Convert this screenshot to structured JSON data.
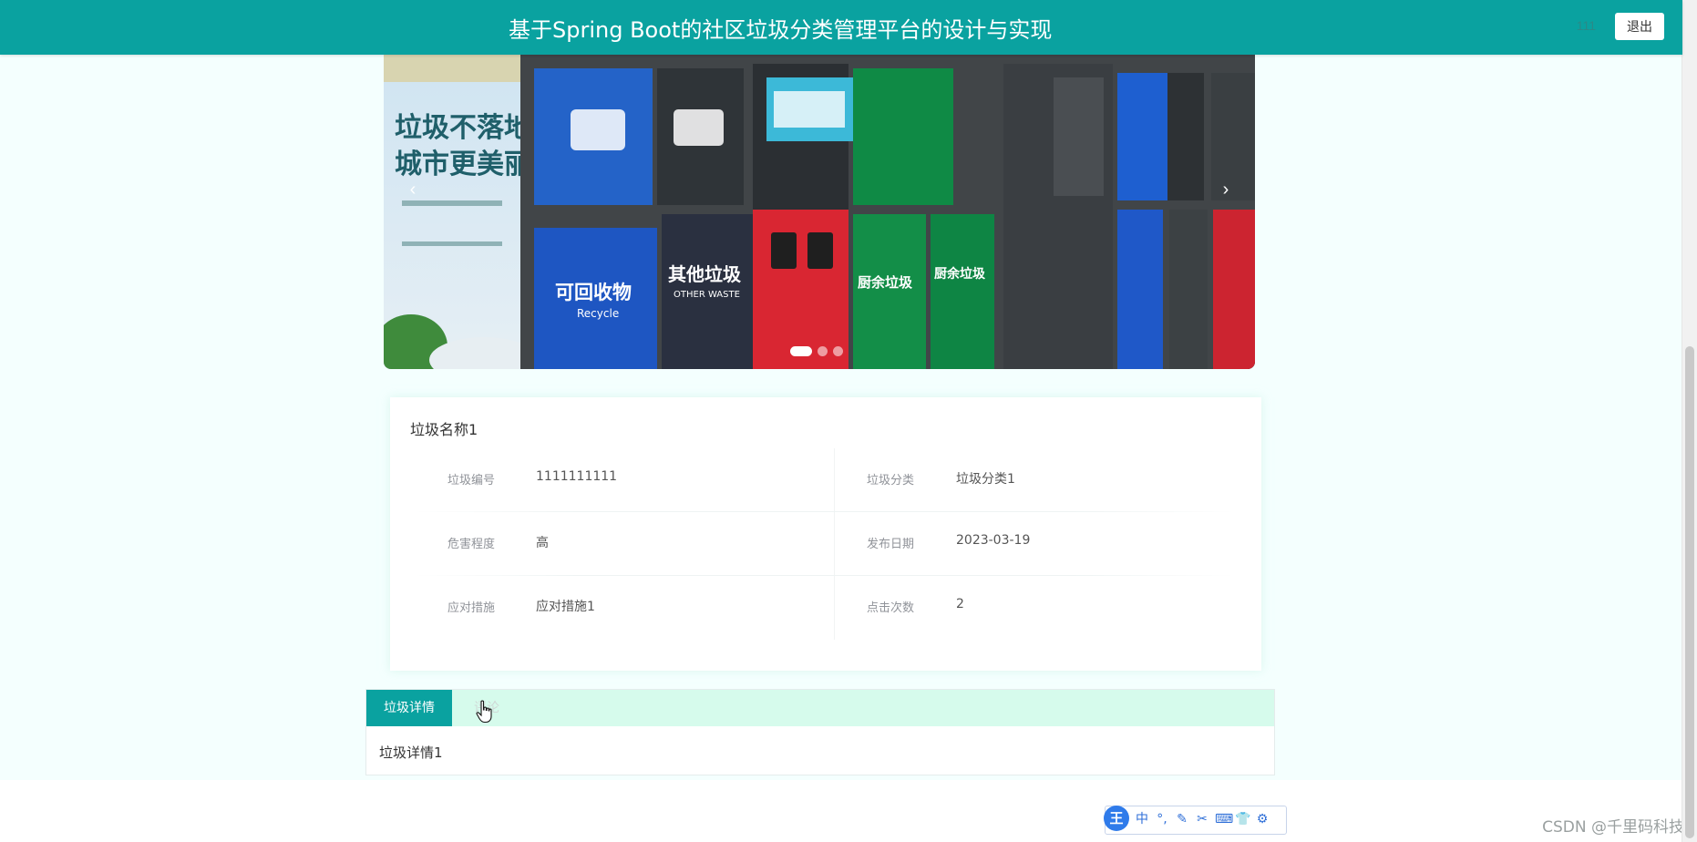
{
  "header": {
    "title": "基于Spring Boot的社区垃圾分类管理平台的设计与实现",
    "username": "111",
    "logout_label": "退出"
  },
  "carousel": {
    "prev_arrow": "‹",
    "next_arrow": "›",
    "slide_count": 3,
    "active_index": 0,
    "image_text": {
      "slogan_line1": "垃圾不落地",
      "slogan_line2": "城市更美丽",
      "bin_recycle": "可回收物",
      "bin_recycle_en": "Recycle",
      "bin_other": "其他垃圾",
      "bin_other_en": "OTHER WASTE",
      "bin_kitchen1": "厨余垃圾",
      "bin_kitchen2": "厨余垃圾"
    }
  },
  "detail": {
    "name": "垃圾名称1",
    "fields": [
      {
        "label": "垃圾编号",
        "value": "1111111111"
      },
      {
        "label": "垃圾分类",
        "value": "垃圾分类1"
      },
      {
        "label": "危害程度",
        "value": "高"
      },
      {
        "label": "发布日期",
        "value": "2023-03-19"
      },
      {
        "label": "应对措施",
        "value": "应对措施1"
      },
      {
        "label": "点击次数",
        "value": "2"
      }
    ]
  },
  "tabs": {
    "active_label": "垃圾详情",
    "inactive_label": "评论",
    "content": "垃圾详情1"
  },
  "ime": {
    "logo": "王",
    "items": [
      "中",
      "°,",
      "✎",
      "✂",
      "⌨",
      "👕",
      "⚙"
    ]
  },
  "watermark": "CSDN @千里码科技",
  "colors": {
    "primary": "#0aa2a0",
    "tab_bar": "#d6fbec",
    "page_bg": "#f4fffe"
  }
}
